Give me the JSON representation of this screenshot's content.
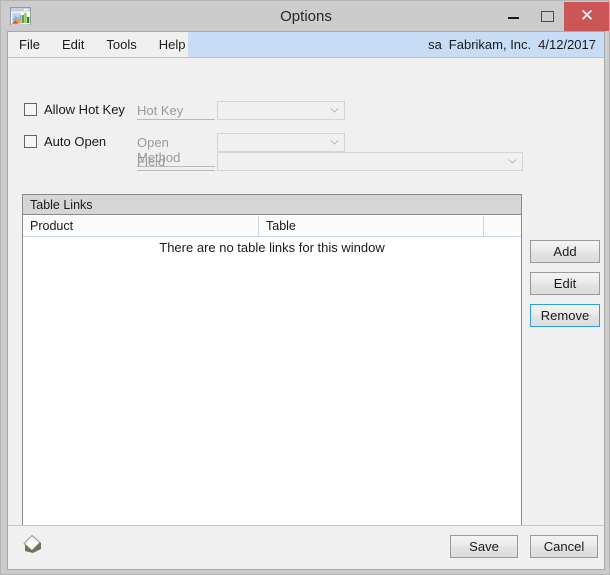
{
  "window": {
    "title": "Options",
    "icon": "window-chart-icon",
    "controls": {
      "minimize": "minimize-button",
      "maximize": "maximize-button",
      "close_glyph": "✕"
    },
    "close_color": "#cc5555"
  },
  "menu": {
    "items": [
      {
        "label": "File"
      },
      {
        "label": "Edit"
      },
      {
        "label": "Tools"
      },
      {
        "label": "Help"
      }
    ]
  },
  "status": {
    "user": "sa",
    "company": "Fabrikam, Inc.",
    "date": "4/12/2017",
    "bg_color": "#c7dcf5"
  },
  "form": {
    "allow_hot_key": {
      "checkbox_label": "Allow Hot Key",
      "checked": false,
      "field_label": "Hot Key",
      "field_value": "",
      "disabled": true
    },
    "auto_open": {
      "checkbox_label": "Auto Open",
      "checked": false,
      "field_label": "Open Method",
      "field_value": "",
      "disabled": true
    },
    "field_row": {
      "field_label": "Field",
      "field_value": "",
      "disabled": true
    }
  },
  "table_links": {
    "group_title": "Table Links",
    "columns": [
      "Product",
      "Table",
      ""
    ],
    "rows": [],
    "empty_message": "There are no table links for this window",
    "buttons": {
      "add": "Add",
      "edit": "Edit",
      "remove": "Remove"
    },
    "focused_button": "Remove",
    "focus_color": "#2f9de0"
  },
  "footer": {
    "note_icon": "note-icon",
    "save": "Save",
    "cancel": "Cancel"
  }
}
